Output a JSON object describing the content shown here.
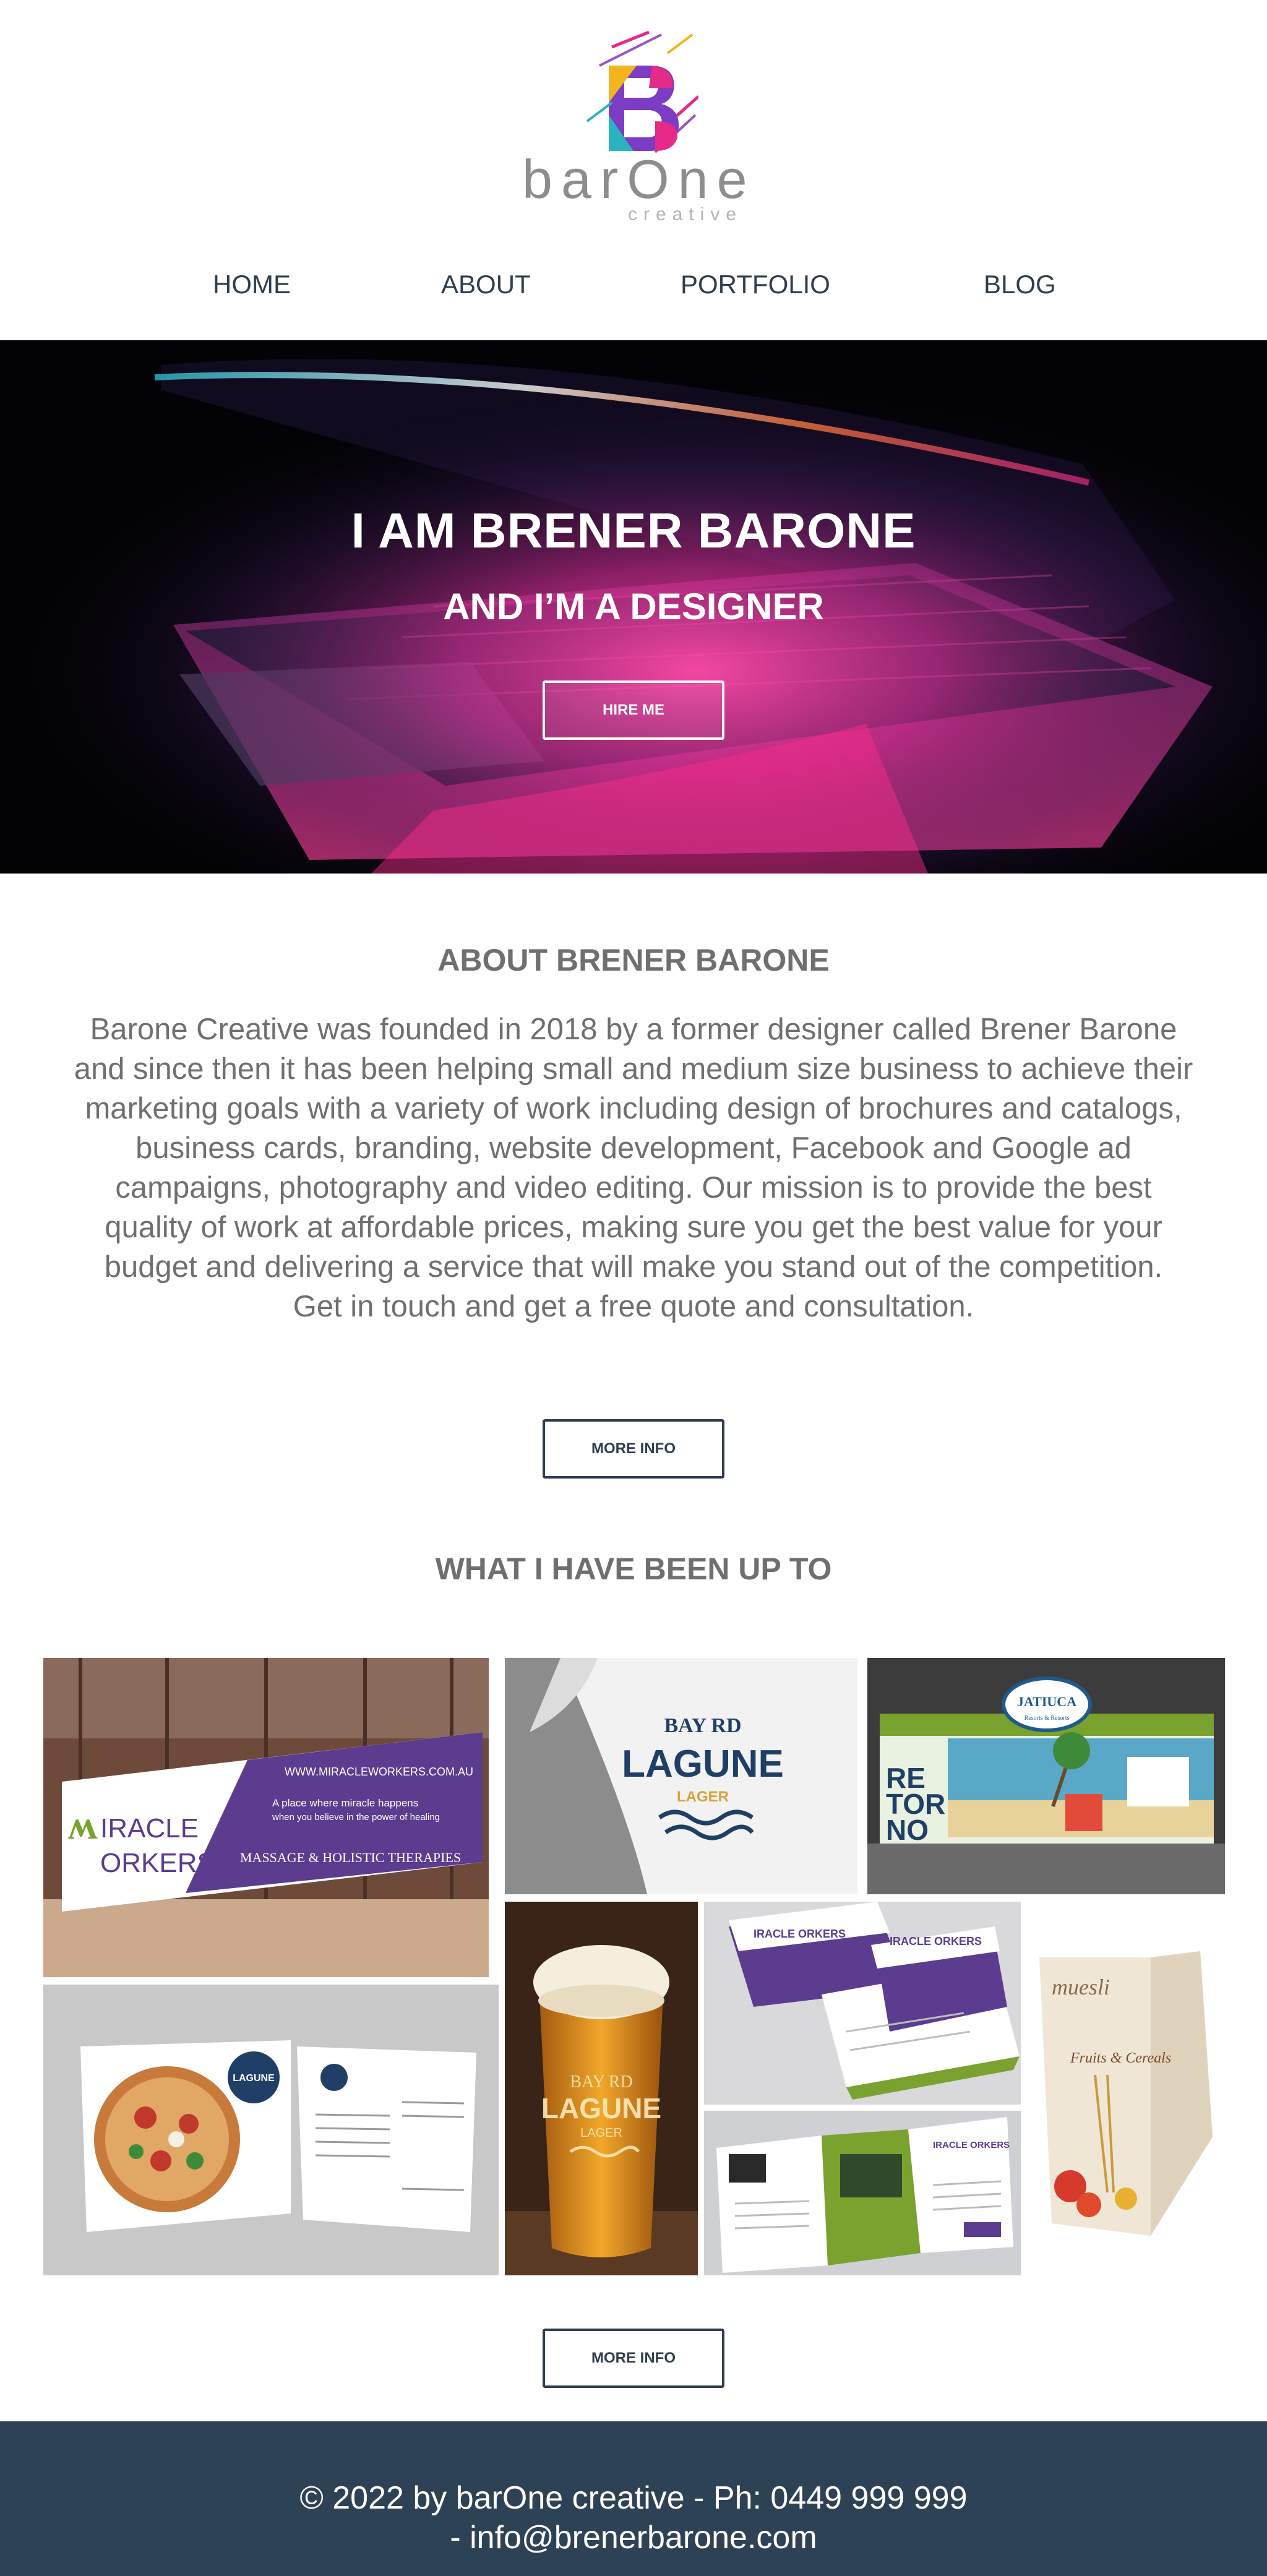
{
  "brand": {
    "name": "barOne",
    "tagline": "creative"
  },
  "nav": {
    "items": [
      "HOME",
      "ABOUT",
      "PORTFOLIO",
      "BLOG"
    ]
  },
  "hero": {
    "title": "I AM BRENER BARONE",
    "subtitle": "AND I’M A DESIGNER",
    "button_label": "HIRE ME"
  },
  "about": {
    "title": "ABOUT BRENER BARONE",
    "paragraph": "Barone Creative was founded in 2018 by a former designer called Brener Barone and since then it has been helping small and medium size business to achieve their marketing goals with a variety of work including design of brochures and catalogs, business cards, branding, website development, Facebook and Google ad campaigns, photography and video editing. Our mission is to provide the best quality of work at affordable prices, making sure you get the best value for your budget and delivering a service that will make you stand out of the competition.",
    "cta_line": "Get in touch and get a free quote and consultation.",
    "button_label": "MORE INFO"
  },
  "portfolio": {
    "title": "WHAT I HAVE BEEN UP TO",
    "button_label": "MORE INFO",
    "tiles": [
      {
        "icon": "shopfront-signage-image",
        "url": "WWW.MIRACLEWORKERS.COM.AU",
        "brand_line1": "IRACLE",
        "brand_line2": "ORKERS",
        "tagline_1": "A place where miracle happens",
        "tagline_2": "when you believe in the power of healing",
        "service": "MASSAGE & HOLISTIC THERAPIES"
      },
      {
        "icon": "bay-rd-lagune-logo-image",
        "top": "BAY RD",
        "name": "LAGUNE",
        "sub": "LAGER"
      },
      {
        "icon": "exhibition-booth-image",
        "banner": "JATIUCA",
        "banner_sub": "Resorts & Resorts",
        "letters_1": "RE",
        "letters_2": "TOR",
        "letters_3": "NO"
      },
      {
        "icon": "beer-glass-image",
        "top": "BAY RD",
        "name": "LAGUNE",
        "sub": "LAGER"
      },
      {
        "icon": "business-cards-image",
        "brand": "IRACLE ORKERS"
      },
      {
        "icon": "cereal-box-image",
        "brand": "muesli",
        "flavor": "Fruits & Cereals"
      },
      {
        "icon": "pizza-menu-image",
        "name": "LAGUNE"
      },
      {
        "icon": "trifold-brochure-image",
        "brand": "IRACLE ORKERS"
      }
    ]
  },
  "footer": {
    "line1": "© 2022 by barOne creative - Ph: 0449 999 999",
    "line2": "- info@brenerbarone.com"
  },
  "colors": {
    "navy": "#2e3e4e",
    "footer_bg": "#2e4256",
    "text_gray": "#6f6f6f",
    "accent_purple": "#5b3c8f",
    "accent_green": "#7aa22f"
  }
}
